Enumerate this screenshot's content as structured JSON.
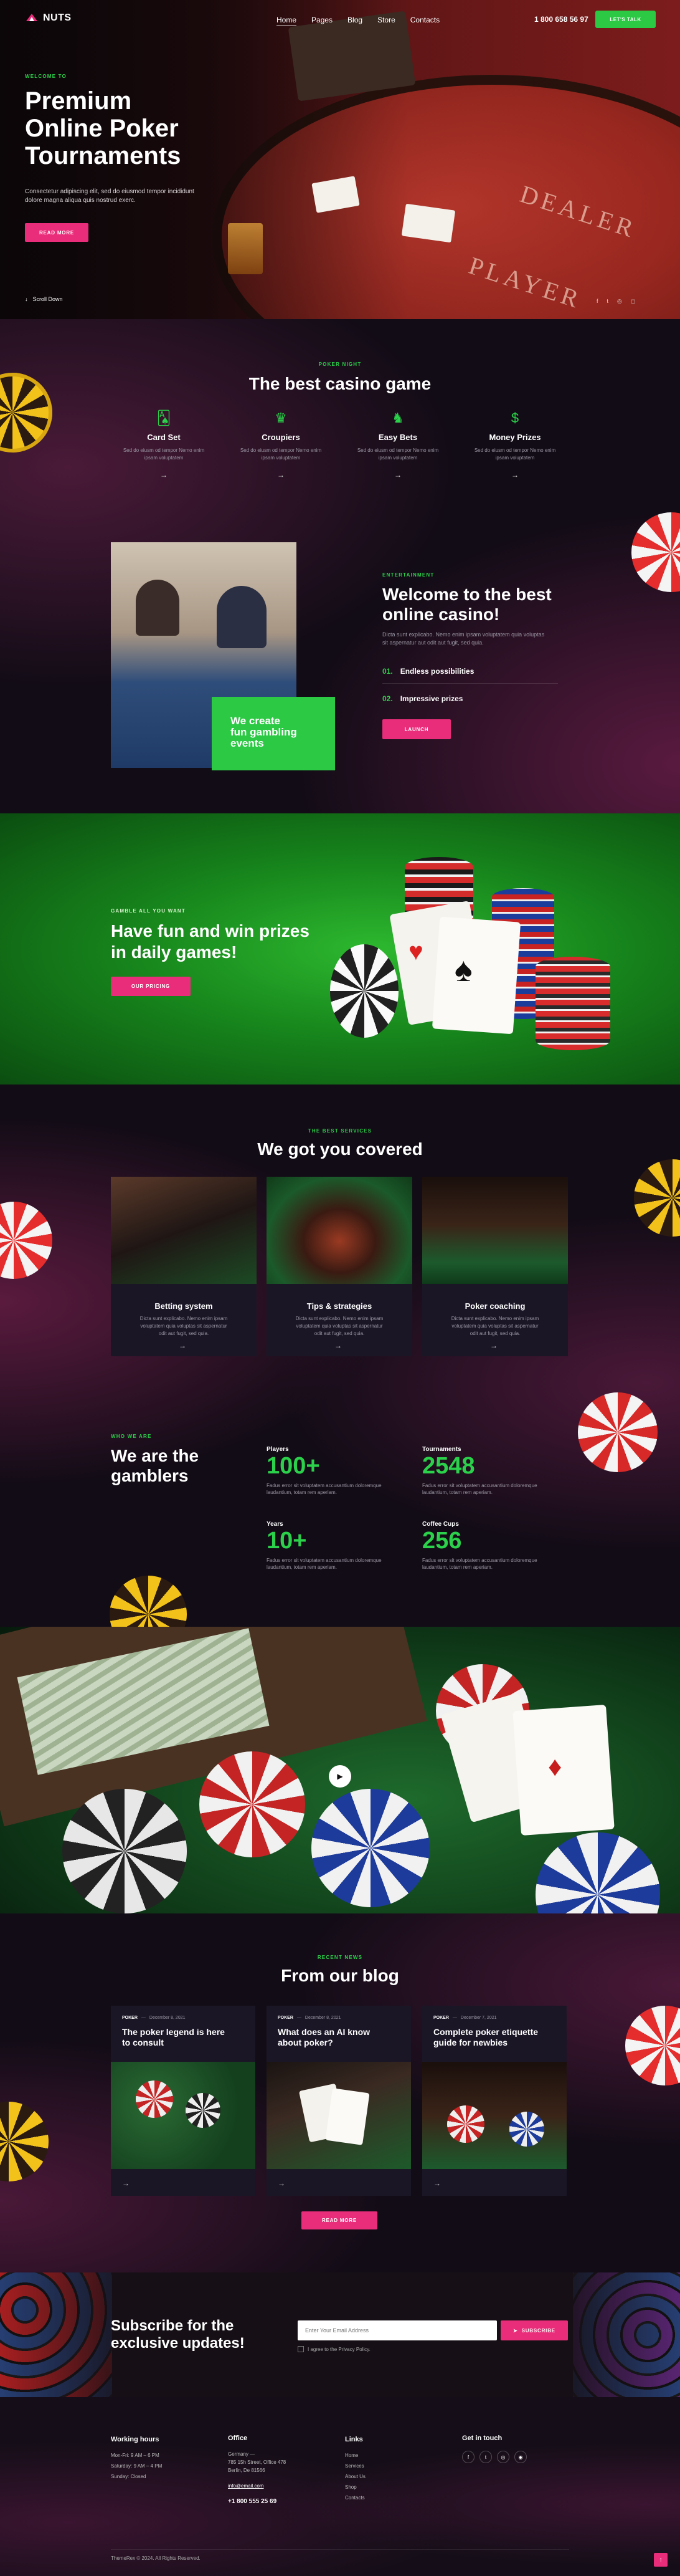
{
  "header": {
    "logo": "NUTS",
    "nav": [
      "Home",
      "Pages",
      "Blog",
      "Store",
      "Contacts"
    ],
    "phone": "1 800 658 56 97",
    "cta": "LET'S TALK"
  },
  "hero": {
    "eyebrow": "WELCOME TO",
    "title_lines": [
      "Premium",
      "Online Poker",
      "Tournaments"
    ],
    "text_lines": [
      "Consectetur adipiscing elit, sed do eiusmod tempor incididunt",
      "dolore magna aliqua quis nostrud exerc."
    ],
    "button": "READ MORE",
    "scroll": "Scroll Down",
    "table_text_1": "DEALER",
    "table_text_2": "PLAYER"
  },
  "casino": {
    "eyebrow": "POKER NIGHT",
    "title": "The best casino game",
    "items": [
      {
        "title": "Card Set",
        "text_lines": [
          "Sed do eiusm od tempor Nemo enim",
          "ipsam voluptatem"
        ]
      },
      {
        "title": "Croupiers",
        "text_lines": [
          "Sed do eiusm od tempor Nemo enim",
          "ipsam voluptatem"
        ]
      },
      {
        "title": "Easy Bets",
        "text_lines": [
          "Sed do eiusm od tempor Nemo enim",
          "ipsam voluptatem"
        ]
      },
      {
        "title": "Money Prizes",
        "text_lines": [
          "Sed do eiusm od tempor Nemo enim",
          "ipsam voluptatem"
        ]
      }
    ]
  },
  "welcome": {
    "eyebrow": "ENTERTAINMENT",
    "title_lines": [
      "Welcome to the best",
      "online casino!"
    ],
    "text_lines": [
      "Dicta sunt explicabo. Nemo enim ipsam voluptatem quia voluptas",
      "sit aspernatur aut odit aut fugit, sed quia."
    ],
    "list": [
      {
        "num": "01.",
        "label": "Endless possibilities"
      },
      {
        "num": "02.",
        "label": "Impressive prizes"
      }
    ],
    "button": "LAUNCH",
    "box_lines": [
      "We create",
      "fun gambling",
      "events"
    ]
  },
  "prizes": {
    "eyebrow": "GAMBLE ALL YOU WANT",
    "title_lines": [
      "Have fun and win prizes",
      "in daily games!"
    ],
    "button": "OUR PRICING"
  },
  "services": {
    "eyebrow": "THE BEST SERVICES",
    "title": "We got you covered",
    "items": [
      {
        "title": "Betting system",
        "text_lines": [
          "Dicta sunt explicabo. Nemo enim ipsam",
          "voluptatem quia voluptas sit aspernatur",
          "odit aut fugit, sed quia."
        ]
      },
      {
        "title": "Tips & strategies",
        "text_lines": [
          "Dicta sunt explicabo. Nemo enim ipsam",
          "voluptatem quia voluptas sit aspernatur",
          "odit aut fugit, sed quia."
        ]
      },
      {
        "title": "Poker coaching",
        "text_lines": [
          "Dicta sunt explicabo. Nemo enim ipsam",
          "voluptatem quia voluptas sit aspernatur",
          "odit aut fugit, sed quia."
        ]
      }
    ]
  },
  "gamblers": {
    "eyebrow": "WHO WE ARE",
    "title_lines": [
      "We are the",
      "gamblers"
    ],
    "stats": [
      {
        "label": "Players",
        "value": "100+",
        "text_lines": [
          "Fadus error sit voluptatem accusantium doloremque",
          "laudantium, totam rem aperiam."
        ]
      },
      {
        "label": "Tournaments",
        "value": "2548",
        "text_lines": [
          "Fadus error sit voluptatem accusantium doloremque",
          "laudantium, totam rem aperiam."
        ]
      },
      {
        "label": "Years",
        "value": "10+",
        "text_lines": [
          "Fadus error sit voluptatem accusantium doloremque",
          "laudantium, totam rem aperiam."
        ]
      },
      {
        "label": "Coffee Cups",
        "value": "256",
        "text_lines": [
          "Fadus error sit voluptatem accusantium doloremque",
          "laudantium, totam rem aperiam."
        ]
      }
    ]
  },
  "blog": {
    "eyebrow": "RECENT NEWS",
    "title": "From our blog",
    "button": "READ MORE",
    "posts": [
      {
        "cat": "POKER",
        "date": "December 8, 2021",
        "title_lines": [
          "The poker legend is here",
          "to consult"
        ]
      },
      {
        "cat": "POKER",
        "date": "December 8, 2021",
        "title_lines": [
          "What does an AI know",
          "about poker?"
        ]
      },
      {
        "cat": "POKER",
        "date": "December 7, 2021",
        "title_lines": [
          "Complete poker etiquette",
          "guide for newbies"
        ]
      }
    ]
  },
  "subscribe": {
    "title_lines": [
      "Subscribe for the",
      "exclusive updates!"
    ],
    "placeholder": "Enter Your Email Address",
    "button": "SUBSCRIBE",
    "agree": "I agree to the Privacy Policy."
  },
  "footer": {
    "hours_title": "Working hours",
    "hours": [
      "Mon-Fri: 9 AM – 6 PM",
      "Saturday: 9 AM – 4 PM",
      "Sunday: Closed"
    ],
    "office_title": "Office",
    "office": [
      "Germany —",
      "785 15h Street, Office 478",
      "Berlin, De 81566"
    ],
    "email": "info@email.com",
    "phone": "+1 800 555 25 69",
    "links_title": "Links",
    "links": [
      "Home",
      "Services",
      "About Us",
      "Shop",
      "Contacts"
    ],
    "touch_title": "Get in touch",
    "copyright": "ThemeRex © 2024. All Rights Reserved."
  },
  "colors": {
    "accent_pink": "#ea2d7a",
    "accent_green": "#2bc944",
    "bg": "#0f0b13",
    "card": "#1b1626"
  }
}
